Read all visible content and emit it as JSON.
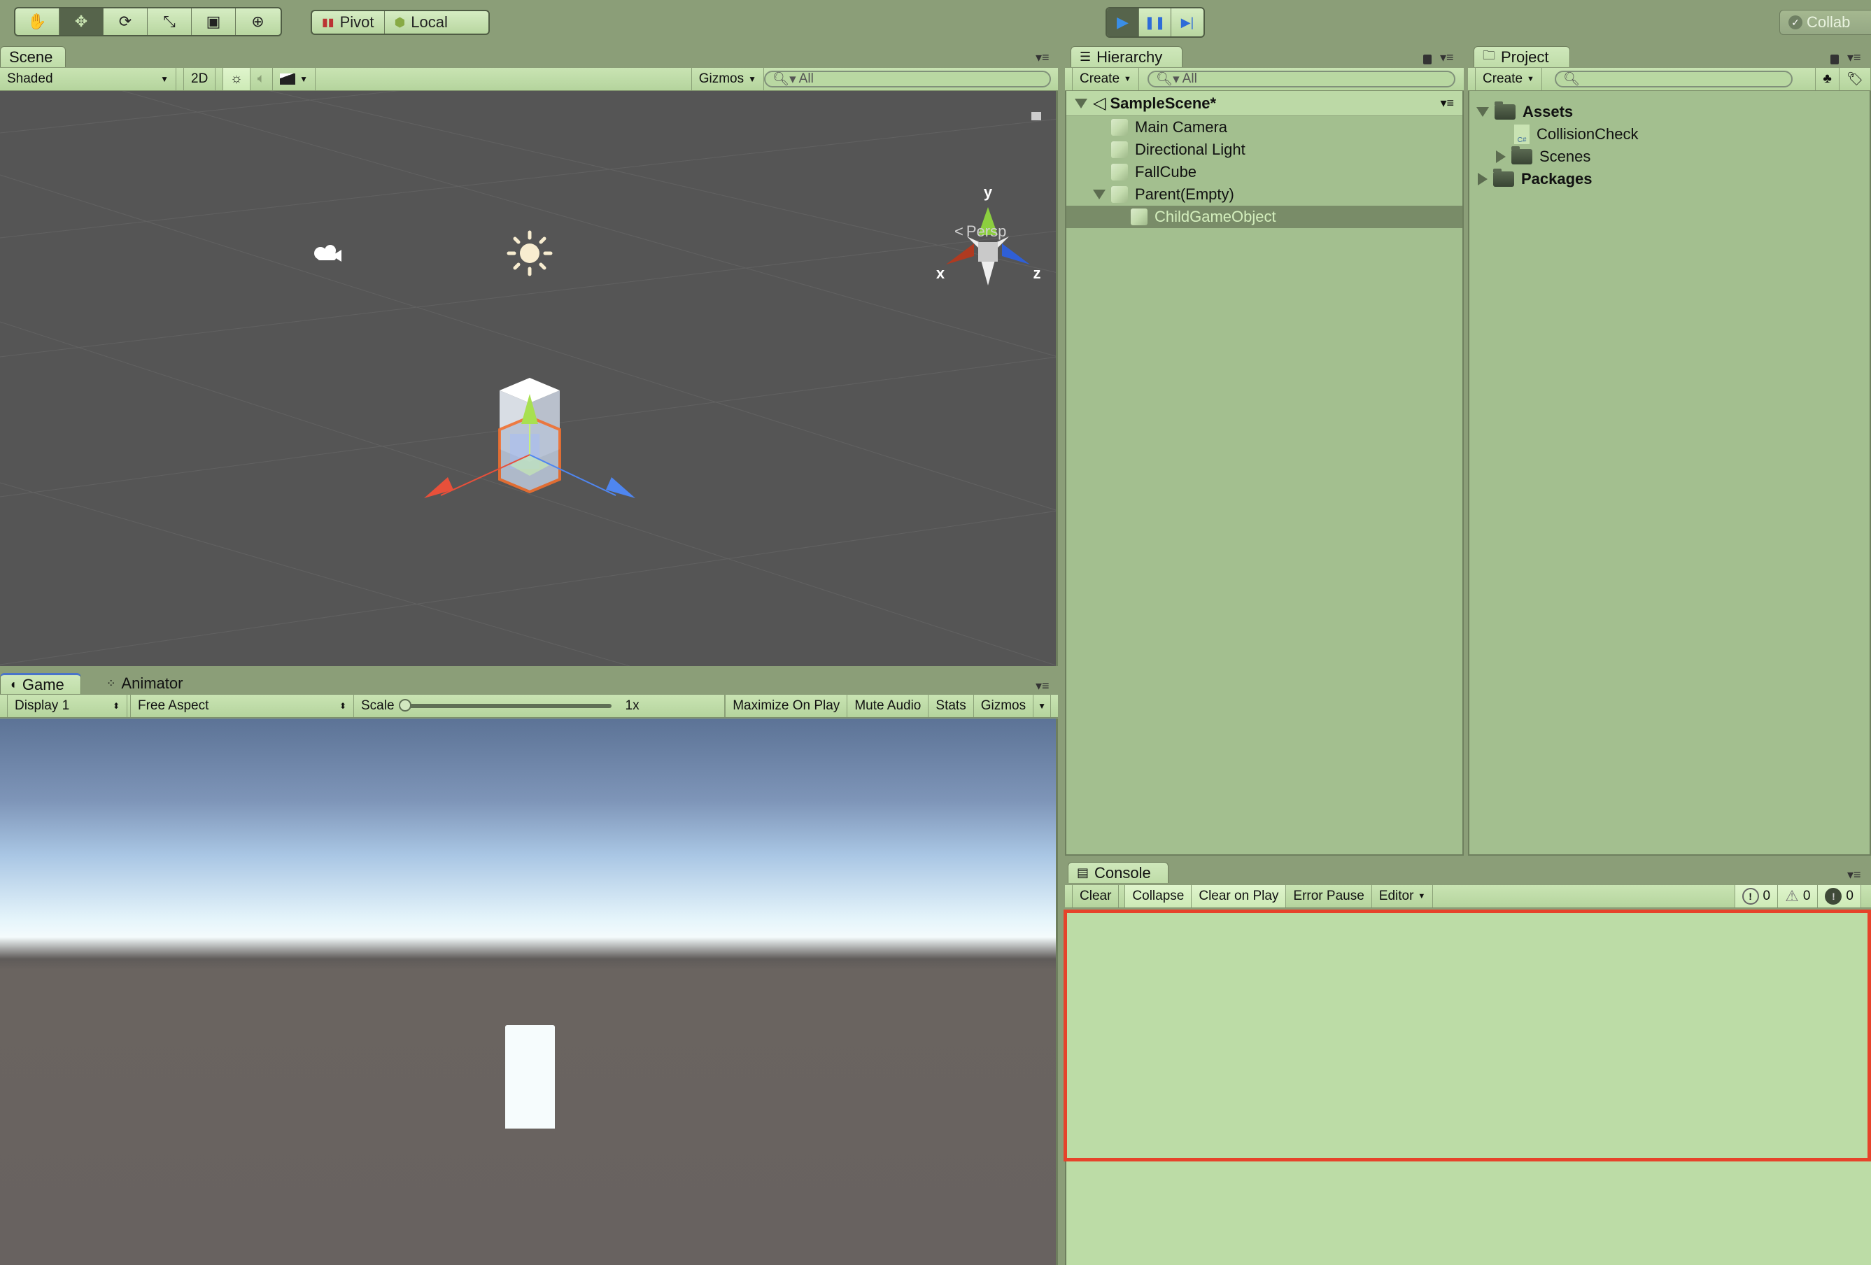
{
  "toolbar": {
    "tools": [
      {
        "name": "hand-tool",
        "glyph": "✋",
        "active": false
      },
      {
        "name": "move-tool",
        "glyph": "✥",
        "active": true
      },
      {
        "name": "rotate-tool",
        "glyph": "⟳",
        "active": false
      },
      {
        "name": "scale-tool",
        "glyph": "⤡",
        "active": false
      },
      {
        "name": "rect-tool",
        "glyph": "▣",
        "active": false
      },
      {
        "name": "transform-tool",
        "glyph": "⊕",
        "active": false
      }
    ],
    "pivot_label": "Pivot",
    "local_label": "Local",
    "play_glyph": "▶",
    "pause_glyph": "❚❚",
    "step_glyph": "▶|",
    "collab_label": "Collab"
  },
  "scene": {
    "tab_label": "Scene",
    "shading_mode": "Shaded",
    "mode_2d": "2D",
    "gizmos_label": "Gizmos",
    "search_placeholder": "All",
    "persp_label": "Persp",
    "axis_x": "x",
    "axis_y": "y",
    "axis_z": "z"
  },
  "game": {
    "tab_label": "Game",
    "animator_tab_label": "Animator",
    "display": "Display 1",
    "aspect": "Free Aspect",
    "scale_label": "Scale",
    "scale_value": "1x",
    "scale_fraction": 0.0,
    "maximize_label": "Maximize On Play",
    "mute_label": "Mute Audio",
    "stats_label": "Stats",
    "gizmos_label": "Gizmos"
  },
  "hierarchy": {
    "tab_label": "Hierarchy",
    "create_label": "Create",
    "search_placeholder": "All",
    "scene_name": "SampleScene*",
    "items": [
      {
        "label": "Main Camera",
        "indent": 1,
        "expanded": null,
        "selected": false
      },
      {
        "label": "Directional Light",
        "indent": 1,
        "expanded": null,
        "selected": false
      },
      {
        "label": "FallCube",
        "indent": 1,
        "expanded": null,
        "selected": false
      },
      {
        "label": "Parent(Empty)",
        "indent": 1,
        "expanded": true,
        "selected": false
      },
      {
        "label": "ChildGameObject",
        "indent": 2,
        "expanded": null,
        "selected": true
      }
    ]
  },
  "project": {
    "tab_label": "Project",
    "create_label": "Create",
    "search_placeholder": "",
    "items": [
      {
        "label": "Assets",
        "type": "folder",
        "bold": true,
        "indent": 0,
        "expanded": true
      },
      {
        "label": "CollisionCheck",
        "type": "script",
        "bold": false,
        "indent": 1,
        "expanded": null
      },
      {
        "label": "Scenes",
        "type": "folder",
        "bold": false,
        "indent": 1,
        "expanded": false
      },
      {
        "label": "Packages",
        "type": "folder",
        "bold": true,
        "indent": 0,
        "expanded": false
      }
    ]
  },
  "console": {
    "tab_label": "Console",
    "clear_label": "Clear",
    "collapse_label": "Collapse",
    "clear_on_play_label": "Clear on Play",
    "error_pause_label": "Error Pause",
    "editor_label": "Editor",
    "info_count": "0",
    "warning_count": "0",
    "error_count": "0",
    "highlight_color": "#e6432a"
  }
}
